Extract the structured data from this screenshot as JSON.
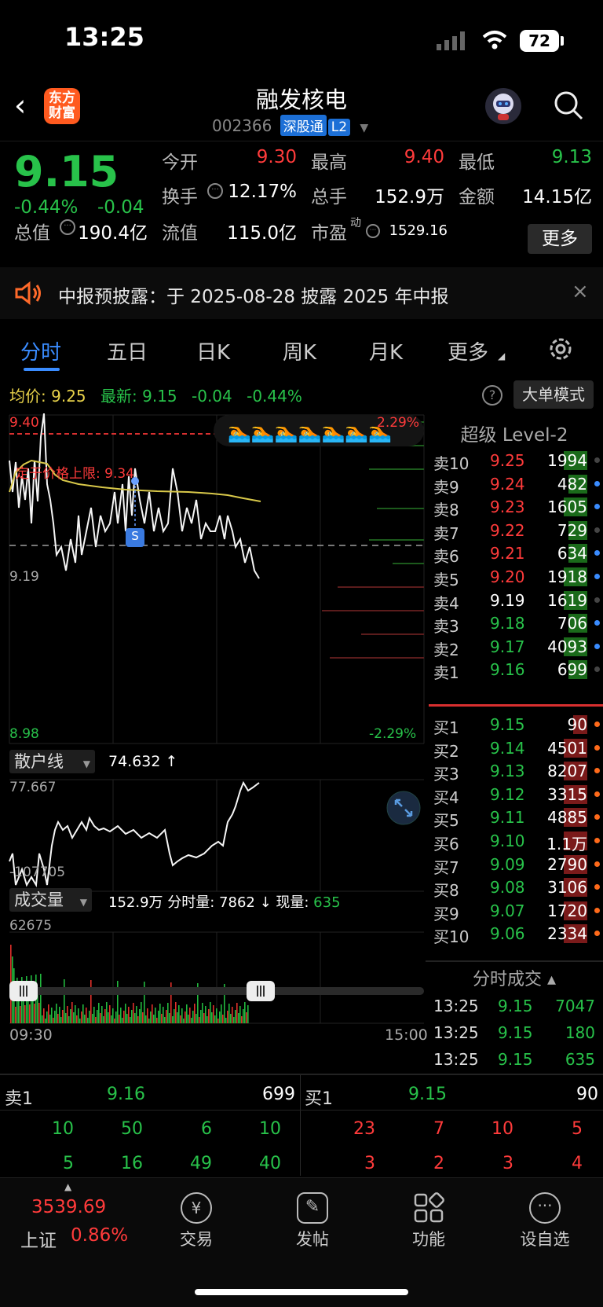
{
  "status": {
    "time": "13:25",
    "battery": "72"
  },
  "header": {
    "name": "融发核电",
    "code": "002366",
    "tag1": "深股通",
    "tag2": "L2",
    "logo_line1": "东方",
    "logo_line2": "财富"
  },
  "quote": {
    "price": "9.15",
    "pct": "-0.44%",
    "chg": "-0.04",
    "open_l": "今开",
    "open_v": "9.30",
    "high_l": "最高",
    "high_v": "9.40",
    "low_l": "最低",
    "low_v": "9.13",
    "turn_l": "换手",
    "turn_v": "12.17%",
    "vol_l": "总手",
    "vol_v": "152.9万",
    "amt_l": "金额",
    "amt_v": "14.15亿",
    "mcap_l": "总值",
    "mcap_v": "190.4亿",
    "float_l": "流值",
    "float_v": "115.0亿",
    "pe_l": "市盈",
    "pe_sup": "动",
    "pe_v": "1529.16",
    "more": "更多"
  },
  "notice": {
    "text": "中报预披露：于 2025-08-28 披露 2025 年中报",
    "close": "×"
  },
  "tabs": [
    {
      "label": "分时"
    },
    {
      "label": "五日"
    },
    {
      "label": "日K"
    },
    {
      "label": "周K"
    },
    {
      "label": "月K"
    },
    {
      "label": "更多"
    }
  ],
  "avg": {
    "avg_l": "均价:",
    "avg_v": "9.25",
    "new_l": "最新:",
    "new_v": "9.15",
    "chg": "-0.04",
    "pct": "-0.44%",
    "help": "?",
    "bigorder": "大单模式"
  },
  "chart": {
    "hi": "9.40",
    "mid": "9.19",
    "lo": "8.98",
    "hi_pct": "2.29%",
    "lo_pct": "-2.29%",
    "limit": "定于价格上限: 9.34",
    "marker": "S",
    "ind_label": "散户线",
    "ind_val": "74.632 ↑",
    "ind_hi": "77.667",
    "ind_lo": "-107705",
    "vol_label": "成交量",
    "vol_info": "152.9万 分时量: 7862 ↓ 现量:",
    "vol_now": "635",
    "vol_max": "62675",
    "t_start": "09:30",
    "t_end": "15:00"
  },
  "orderbook": {
    "title": "超级 Level-2",
    "sell": [
      {
        "l": "卖10",
        "p": "9.25",
        "v": "1994",
        "c": "red"
      },
      {
        "l": "卖9",
        "p": "9.24",
        "v": "482",
        "c": "red"
      },
      {
        "l": "卖8",
        "p": "9.23",
        "v": "1605",
        "c": "red"
      },
      {
        "l": "卖7",
        "p": "9.22",
        "v": "729",
        "c": "red"
      },
      {
        "l": "卖6",
        "p": "9.21",
        "v": "634",
        "c": "red"
      },
      {
        "l": "卖5",
        "p": "9.20",
        "v": "1918",
        "c": "red"
      },
      {
        "l": "卖4",
        "p": "9.19",
        "v": "1619",
        "c": "white"
      },
      {
        "l": "卖3",
        "p": "9.18",
        "v": "706",
        "c": "green"
      },
      {
        "l": "卖2",
        "p": "9.17",
        "v": "4093",
        "c": "green"
      },
      {
        "l": "卖1",
        "p": "9.16",
        "v": "699",
        "c": "green"
      }
    ],
    "buy": [
      {
        "l": "买1",
        "p": "9.15",
        "v": "90",
        "c": "green"
      },
      {
        "l": "买2",
        "p": "9.14",
        "v": "4501",
        "c": "green"
      },
      {
        "l": "买3",
        "p": "9.13",
        "v": "8207",
        "c": "green"
      },
      {
        "l": "买4",
        "p": "9.12",
        "v": "3315",
        "c": "green"
      },
      {
        "l": "买5",
        "p": "9.11",
        "v": "4885",
        "c": "green"
      },
      {
        "l": "买6",
        "p": "9.10",
        "v": "1.1万",
        "c": "green"
      },
      {
        "l": "买7",
        "p": "9.09",
        "v": "2790",
        "c": "green"
      },
      {
        "l": "买8",
        "p": "9.08",
        "v": "3106",
        "c": "green"
      },
      {
        "l": "买9",
        "p": "9.07",
        "v": "1720",
        "c": "green"
      },
      {
        "l": "买10",
        "p": "9.06",
        "v": "2334",
        "c": "green"
      }
    ]
  },
  "ticks": {
    "title": "分时成交 ▴",
    "rows": [
      {
        "t": "13:25",
        "p": "9.15",
        "v": "7047"
      },
      {
        "t": "13:25",
        "p": "9.15",
        "v": "180"
      },
      {
        "t": "13:25",
        "p": "9.15",
        "v": "635"
      }
    ]
  },
  "bottom": {
    "s_l": "卖1",
    "s_p": "9.16",
    "s_v": "699",
    "b_l": "买1",
    "b_p": "9.15",
    "b_v": "90",
    "s_row1": [
      "10",
      "50",
      "6",
      "10"
    ],
    "s_row2": [
      "5",
      "16",
      "49",
      "40"
    ],
    "b_row1": [
      "23",
      "7",
      "10",
      "5"
    ],
    "b_row2": [
      "3",
      "2",
      "3",
      "4"
    ]
  },
  "nav": {
    "index_v": "3539.69",
    "index_l": "上证",
    "index_pct": "0.86%",
    "items": [
      {
        "label": "交易"
      },
      {
        "label": "发帖"
      },
      {
        "label": "功能"
      },
      {
        "label": "设自选"
      }
    ]
  }
}
